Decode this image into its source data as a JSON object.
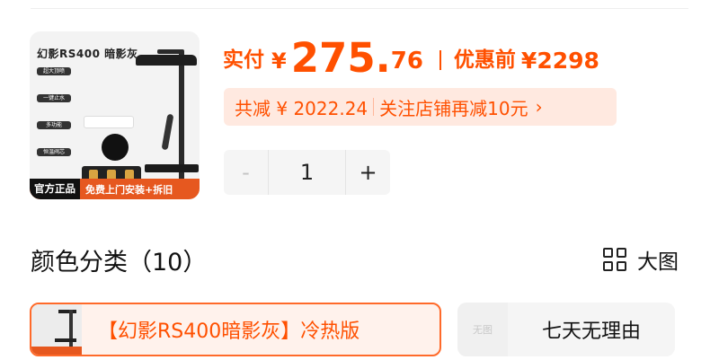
{
  "product": {
    "thumb_title": "幻影RS400 暗影灰",
    "thumb_features": [
      "超大顶喷",
      "一键止水",
      "多功能",
      "恒温阀芯"
    ],
    "badge_official": "官方正品",
    "badge_service": "免费上门安装+拆旧"
  },
  "price": {
    "actual_label": "实付",
    "currency": "¥",
    "actual_int": "275.",
    "actual_dec": "76",
    "original_label": "优惠前",
    "original_value": "¥2298"
  },
  "discount": {
    "total_text": "共减 ¥ 2022.24",
    "follow_text": "关注店铺再减10元",
    "chevron": "›"
  },
  "quantity": {
    "minus": "-",
    "value": "1",
    "plus": "+"
  },
  "section": {
    "title": "颜色分类（10）",
    "big_view_label": "大图"
  },
  "options": [
    {
      "label": "【幻影RS400暗影灰】冷热版",
      "selected": true
    },
    {
      "label": "七天无理由",
      "no_image_text": "无图",
      "selected": false
    }
  ],
  "colors": {
    "accent": "#ff5000",
    "pill_bg": "#ffe9e0",
    "selected_border": "#ff6a2a",
    "banner": "#e6581f"
  },
  "icons": [
    "grid-view-icon",
    "chevron-right-icon"
  ]
}
